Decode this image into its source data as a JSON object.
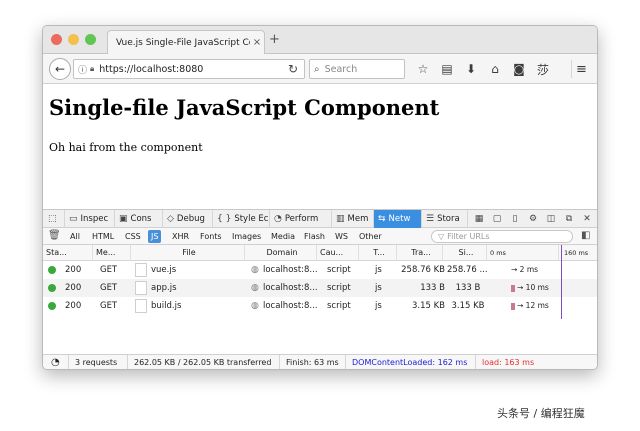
{
  "colors": {
    "close": "#ec6a5f",
    "minimize": "#f5bf4f",
    "maximize": "#61c554",
    "active_tab": "#3b8fe0",
    "dom_loaded": "#1b1bd6",
    "load": "#e03030",
    "status_ok": "#3aa83a",
    "timeline": "#7a4fc4"
  },
  "browser": {
    "tab_title": "Vue.js Single-File JavaScript Com",
    "tab_close": "×",
    "new_tab": "+",
    "url": "https://localhost:8080",
    "search_placeholder": "Search",
    "icons": [
      "star-icon",
      "reading-list-icon",
      "download-icon",
      "home-icon",
      "pocket-icon",
      "translate-icon"
    ],
    "icon_glyphs": [
      "☆",
      "▤",
      "⬇",
      "⌂",
      "◙",
      "莎"
    ]
  },
  "page": {
    "heading": "Single-file JavaScript Component",
    "body_text": "Oh hai from the component"
  },
  "devtools": {
    "tabs": [
      {
        "label": "Inspec",
        "icon": "inspector-icon",
        "glyph": "▭"
      },
      {
        "label": "Cons",
        "icon": "console-icon",
        "glyph": "▣"
      },
      {
        "label": "Debug",
        "icon": "debugger-icon",
        "glyph": "◇"
      },
      {
        "label": "Style Ec",
        "icon": "style-editor-icon",
        "glyph": "{ }"
      },
      {
        "label": "Perform",
        "icon": "performance-icon",
        "glyph": "◔"
      },
      {
        "label": "Mem",
        "icon": "memory-icon",
        "glyph": "▥"
      },
      {
        "label": "Netw",
        "icon": "network-icon",
        "glyph": "⇆"
      },
      {
        "label": "Stora",
        "icon": "storage-icon",
        "glyph": "☰"
      }
    ],
    "filters": [
      "All",
      "HTML",
      "CSS",
      "JS",
      "XHR",
      "Fonts",
      "Images",
      "Media",
      "Flash",
      "WS",
      "Other"
    ],
    "active_filter": "JS",
    "filter_url_placeholder": "Filter URLs",
    "columns": [
      "Sta...",
      "Me...",
      "File",
      "Domain",
      "Cau...",
      "T...",
      "Tra...",
      "Si...",
      "0 ms",
      "160 ms"
    ],
    "requests": [
      {
        "status": "200",
        "method": "GET",
        "file": "vue.js",
        "domain": "localhost:8...",
        "cause": "script",
        "type": "js",
        "transferred": "258.76 KB",
        "size": "258.76 ...",
        "timing": "→ 2 ms"
      },
      {
        "status": "200",
        "method": "GET",
        "file": "app.js",
        "domain": "localhost:8...",
        "cause": "script",
        "type": "js",
        "transferred": "133 B",
        "size": "133 B",
        "timing": "→ 10 ms"
      },
      {
        "status": "200",
        "method": "GET",
        "file": "build.js",
        "domain": "localhost:8...",
        "cause": "script",
        "type": "js",
        "transferred": "3.15 KB",
        "size": "3.15 KB",
        "timing": "→ 12 ms"
      }
    ],
    "status": {
      "requests": "3 requests",
      "transferred": "262.05 KB / 262.05 KB transferred",
      "finish": "Finish: 63 ms",
      "dom_loaded": "DOMContentLoaded: 162 ms",
      "load": "load: 163 ms"
    }
  },
  "watermark": "头条号 / 编程狂魔"
}
